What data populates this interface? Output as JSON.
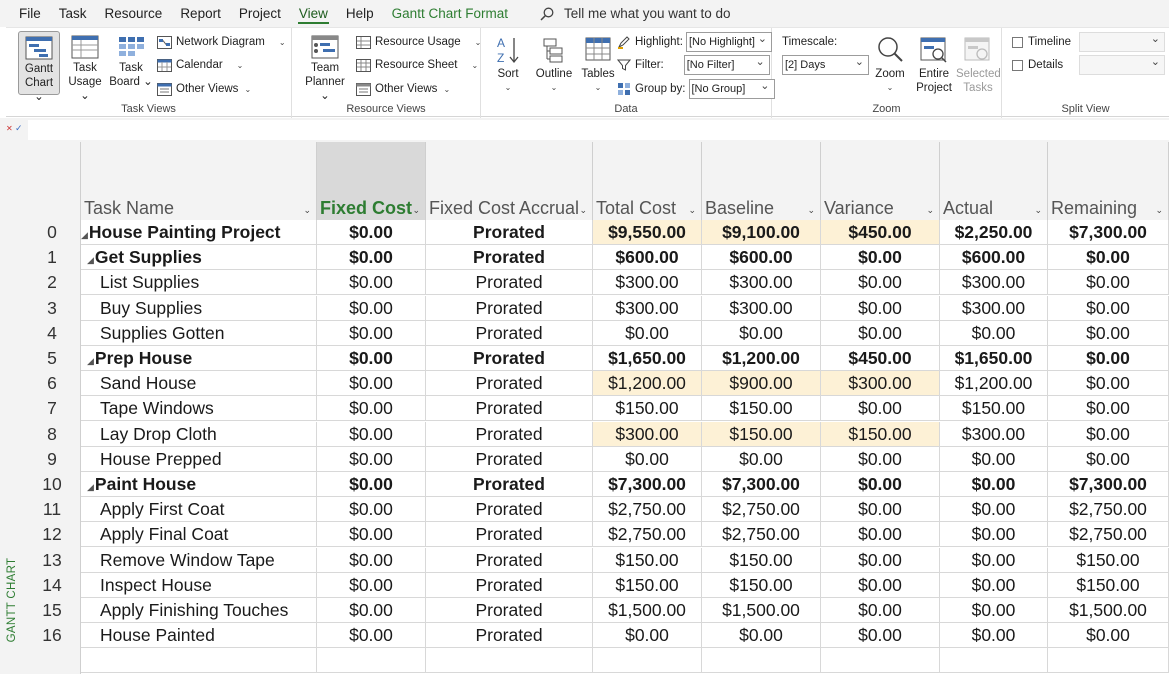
{
  "menu": {
    "items": [
      "File",
      "Task",
      "Resource",
      "Report",
      "Project",
      "View",
      "Help",
      "Gantt Chart Format"
    ],
    "active": "View",
    "tell_me": "Tell me what you want to do"
  },
  "ribbon": {
    "task_views": {
      "label": "Task Views",
      "gantt_chart": [
        "Gantt",
        "Chart ⌄"
      ],
      "task_usage": [
        "Task",
        "Usage ⌄"
      ],
      "task_board": [
        "Task",
        "Board ⌄"
      ],
      "network_diagram": "Network Diagram",
      "calendar": "Calendar",
      "other_views": "Other Views"
    },
    "resource_views": {
      "label": "Resource Views",
      "team_planner": [
        "Team",
        "Planner ⌄"
      ],
      "resource_usage": "Resource Usage",
      "resource_sheet": "Resource Sheet",
      "other_views": "Other Views"
    },
    "data": {
      "label": "Data",
      "sort": "Sort",
      "outline": "Outline",
      "tables": "Tables",
      "highlight_label": "Highlight:",
      "highlight_value": "[No Highlight]",
      "filter_label": "Filter:",
      "filter_value": "[No Filter]",
      "group_label": "Group by:",
      "group_value": "[No Group]"
    },
    "zoom": {
      "label": "Zoom",
      "timescale_label": "Timescale:",
      "timescale_value": "[2] Days",
      "zoom": "Zoom",
      "entire_project": [
        "Entire",
        "Project"
      ],
      "selected_tasks": [
        "Selected",
        "Tasks"
      ]
    },
    "split_view": {
      "label": "Split View",
      "timeline": "Timeline",
      "details": "Details"
    }
  },
  "side_label": "GANTT CHART",
  "columns": [
    "Task Name",
    "Fixed Cost",
    "Fixed Cost Accrual",
    "Total Cost",
    "Baseline",
    "Variance",
    "Actual",
    "Remaining"
  ],
  "selected_column": "Fixed Cost",
  "rows": [
    {
      "id": "0",
      "name": "House Painting Project",
      "level": 0,
      "summary": true,
      "fixed_cost": "$0.00",
      "accrual": "Prorated",
      "total": "$9,550.00",
      "baseline": "$9,100.00",
      "variance": "$450.00",
      "actual": "$2,250.00",
      "remaining": "$7,300.00",
      "highlight": true
    },
    {
      "id": "1",
      "name": "Get Supplies",
      "level": 1,
      "summary": true,
      "fixed_cost": "$0.00",
      "accrual": "Prorated",
      "total": "$600.00",
      "baseline": "$600.00",
      "variance": "$0.00",
      "actual": "$600.00",
      "remaining": "$0.00",
      "highlight": false
    },
    {
      "id": "2",
      "name": "List Supplies",
      "level": 2,
      "summary": false,
      "fixed_cost": "$0.00",
      "accrual": "Prorated",
      "total": "$300.00",
      "baseline": "$300.00",
      "variance": "$0.00",
      "actual": "$300.00",
      "remaining": "$0.00",
      "highlight": false
    },
    {
      "id": "3",
      "name": "Buy Supplies",
      "level": 2,
      "summary": false,
      "fixed_cost": "$0.00",
      "accrual": "Prorated",
      "total": "$300.00",
      "baseline": "$300.00",
      "variance": "$0.00",
      "actual": "$300.00",
      "remaining": "$0.00",
      "highlight": false
    },
    {
      "id": "4",
      "name": "Supplies Gotten",
      "level": 2,
      "summary": false,
      "fixed_cost": "$0.00",
      "accrual": "Prorated",
      "total": "$0.00",
      "baseline": "$0.00",
      "variance": "$0.00",
      "actual": "$0.00",
      "remaining": "$0.00",
      "highlight": false
    },
    {
      "id": "5",
      "name": "Prep House",
      "level": 1,
      "summary": true,
      "fixed_cost": "$0.00",
      "accrual": "Prorated",
      "total": "$1,650.00",
      "baseline": "$1,200.00",
      "variance": "$450.00",
      "actual": "$1,650.00",
      "remaining": "$0.00",
      "highlight": false
    },
    {
      "id": "6",
      "name": "Sand House",
      "level": 2,
      "summary": false,
      "fixed_cost": "$0.00",
      "accrual": "Prorated",
      "total": "$1,200.00",
      "baseline": "$900.00",
      "variance": "$300.00",
      "actual": "$1,200.00",
      "remaining": "$0.00",
      "highlight": true
    },
    {
      "id": "7",
      "name": "Tape Windows",
      "level": 2,
      "summary": false,
      "fixed_cost": "$0.00",
      "accrual": "Prorated",
      "total": "$150.00",
      "baseline": "$150.00",
      "variance": "$0.00",
      "actual": "$150.00",
      "remaining": "$0.00",
      "highlight": false
    },
    {
      "id": "8",
      "name": "Lay Drop Cloth",
      "level": 2,
      "summary": false,
      "fixed_cost": "$0.00",
      "accrual": "Prorated",
      "total": "$300.00",
      "baseline": "$150.00",
      "variance": "$150.00",
      "actual": "$300.00",
      "remaining": "$0.00",
      "highlight": true
    },
    {
      "id": "9",
      "name": "House Prepped",
      "level": 2,
      "summary": false,
      "fixed_cost": "$0.00",
      "accrual": "Prorated",
      "total": "$0.00",
      "baseline": "$0.00",
      "variance": "$0.00",
      "actual": "$0.00",
      "remaining": "$0.00",
      "highlight": false
    },
    {
      "id": "10",
      "name": "Paint House",
      "level": 1,
      "summary": true,
      "fixed_cost": "$0.00",
      "accrual": "Prorated",
      "total": "$7,300.00",
      "baseline": "$7,300.00",
      "variance": "$0.00",
      "actual": "$0.00",
      "remaining": "$7,300.00",
      "highlight": false
    },
    {
      "id": "11",
      "name": "Apply First Coat",
      "level": 2,
      "summary": false,
      "fixed_cost": "$0.00",
      "accrual": "Prorated",
      "total": "$2,750.00",
      "baseline": "$2,750.00",
      "variance": "$0.00",
      "actual": "$0.00",
      "remaining": "$2,750.00",
      "highlight": false
    },
    {
      "id": "12",
      "name": "Apply Final Coat",
      "level": 2,
      "summary": false,
      "fixed_cost": "$0.00",
      "accrual": "Prorated",
      "total": "$2,750.00",
      "baseline": "$2,750.00",
      "variance": "$0.00",
      "actual": "$0.00",
      "remaining": "$2,750.00",
      "highlight": false
    },
    {
      "id": "13",
      "name": "Remove Window Tape",
      "level": 2,
      "summary": false,
      "fixed_cost": "$0.00",
      "accrual": "Prorated",
      "total": "$150.00",
      "baseline": "$150.00",
      "variance": "$0.00",
      "actual": "$0.00",
      "remaining": "$150.00",
      "highlight": false
    },
    {
      "id": "14",
      "name": "Inspect House",
      "level": 2,
      "summary": false,
      "fixed_cost": "$0.00",
      "accrual": "Prorated",
      "total": "$150.00",
      "baseline": "$150.00",
      "variance": "$0.00",
      "actual": "$0.00",
      "remaining": "$150.00",
      "highlight": false
    },
    {
      "id": "15",
      "name": "Apply Finishing Touches",
      "level": 2,
      "summary": false,
      "fixed_cost": "$0.00",
      "accrual": "Prorated",
      "total": "$1,500.00",
      "baseline": "$1,500.00",
      "variance": "$0.00",
      "actual": "$0.00",
      "remaining": "$1,500.00",
      "highlight": false
    },
    {
      "id": "16",
      "name": "House Painted",
      "level": 2,
      "summary": false,
      "fixed_cost": "$0.00",
      "accrual": "Prorated",
      "total": "$0.00",
      "baseline": "$0.00",
      "variance": "$0.00",
      "actual": "$0.00",
      "remaining": "$0.00",
      "highlight": false
    }
  ]
}
